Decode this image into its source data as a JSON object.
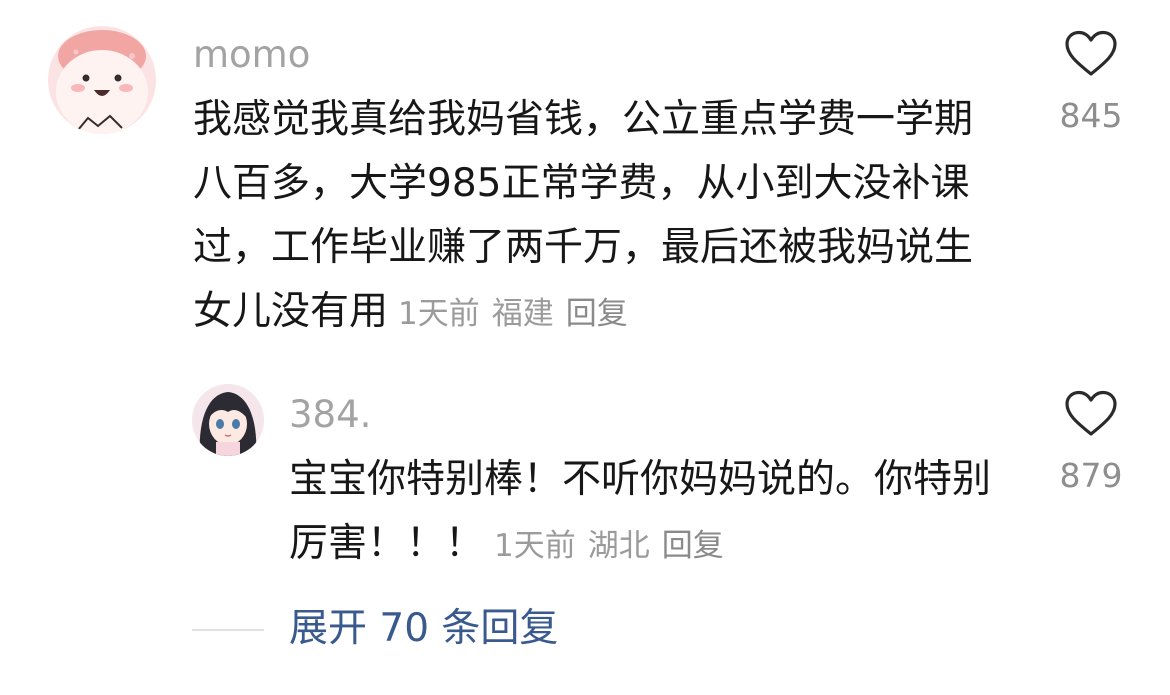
{
  "comment": {
    "username": "momo",
    "text": "我感觉我真给我妈省钱，公立重点学费一学期八百多，大学985正常学费，从小到大没补课过，工作毕业赚了两千万，最后还被我妈说生女儿没有用",
    "time": "1天前",
    "location": "福建",
    "reply_label": "回复",
    "likes": "845",
    "avatar_icon": "pink-cartoon-avatar"
  },
  "reply": {
    "username": "384.",
    "text": "宝宝你特别棒！不听你妈妈说的。你特别厉害！！！",
    "time": "1天前",
    "location": "湖北",
    "reply_label": "回复",
    "likes": "879",
    "avatar_icon": "anime-girl-avatar"
  },
  "expand_label": "展开 70 条回复",
  "colors": {
    "username": "#a3a3a3",
    "text": "#171717",
    "meta": "#9b9b9b",
    "link": "#3a5a8e"
  }
}
